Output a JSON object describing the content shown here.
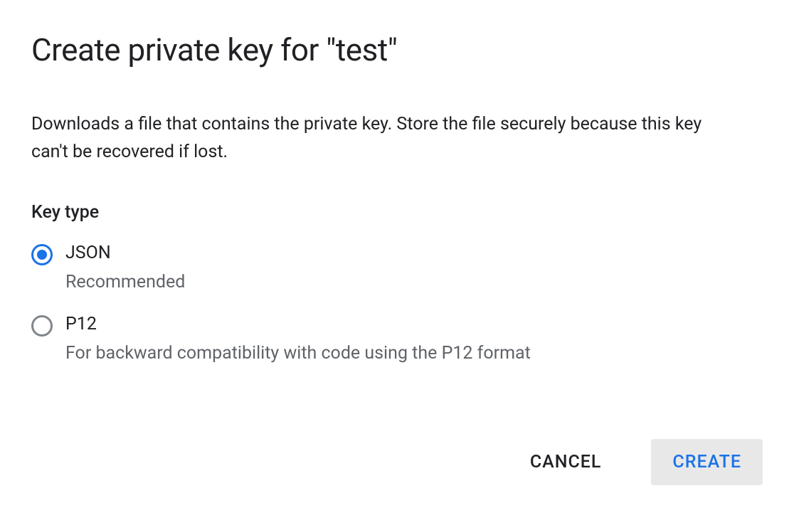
{
  "dialog": {
    "title": "Create private key for \"test\"",
    "description": "Downloads a file that contains the private key. Store the file securely because this key can't be recovered if lost.",
    "section_label": "Key type",
    "options": [
      {
        "label": "JSON",
        "sublabel": "Recommended",
        "selected": true
      },
      {
        "label": "P12",
        "sublabel": "For backward compatibility with code using the P12 format",
        "selected": false
      }
    ],
    "actions": {
      "cancel": "CANCEL",
      "create": "CREATE"
    }
  }
}
